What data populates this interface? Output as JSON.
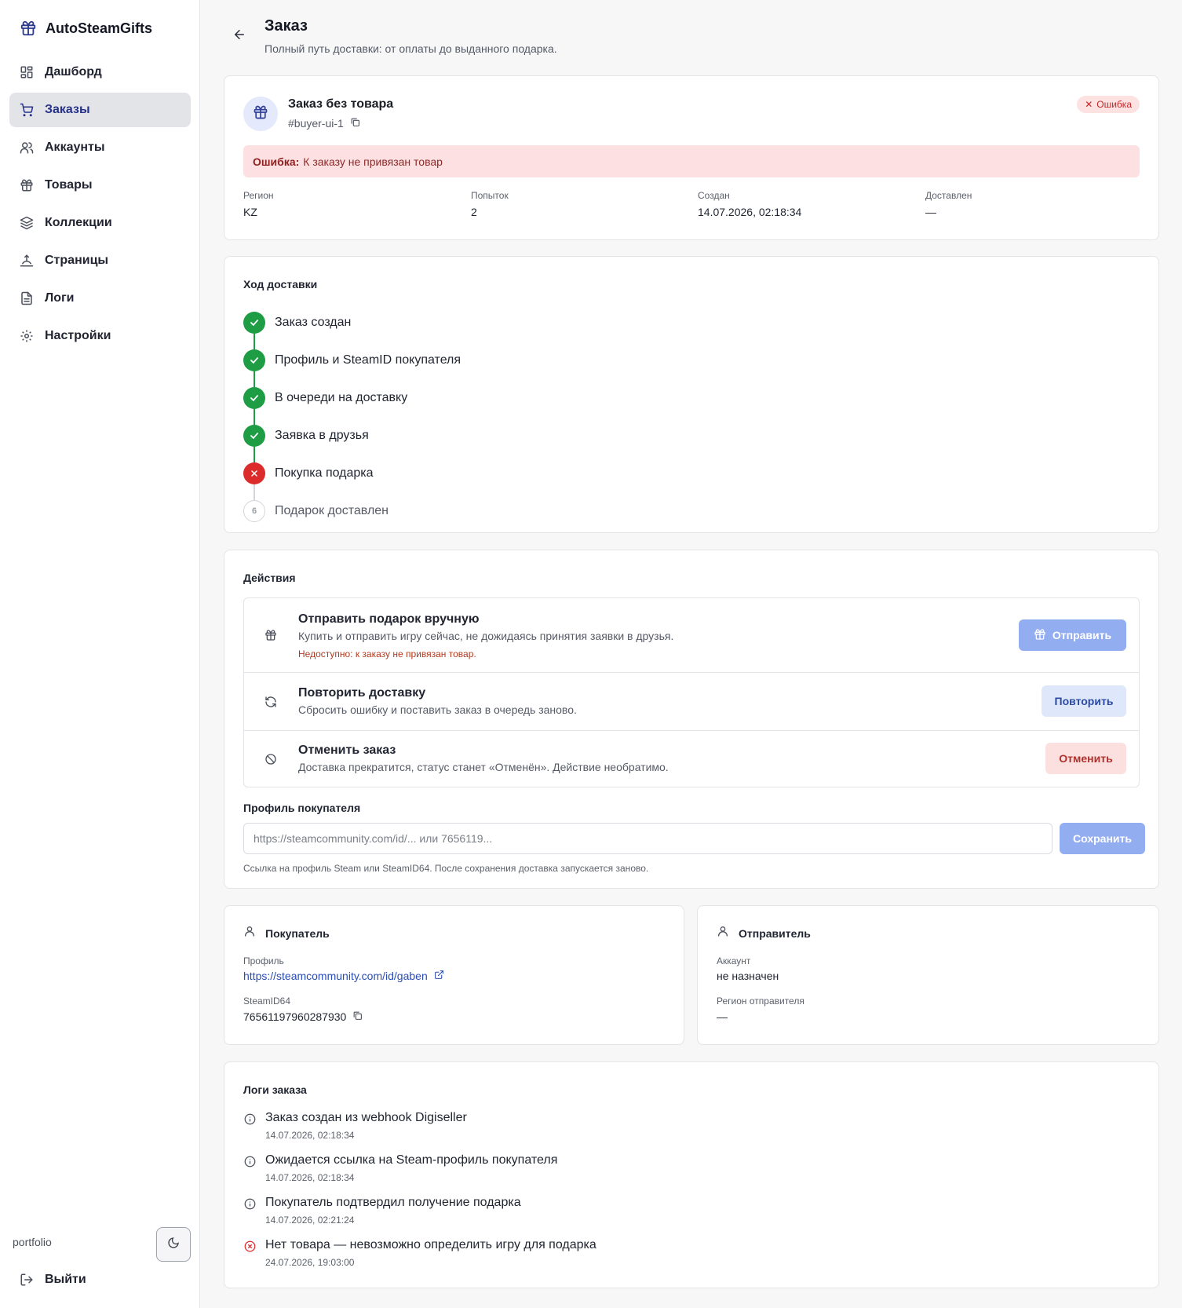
{
  "app": {
    "title": "AutoSteamGifts"
  },
  "sidebar": {
    "items": [
      {
        "label": "Дашборд",
        "icon": "dashboard-icon"
      },
      {
        "label": "Заказы",
        "icon": "cart-icon",
        "active": true
      },
      {
        "label": "Аккаунты",
        "icon": "users-icon"
      },
      {
        "label": "Товары",
        "icon": "gift-icon"
      },
      {
        "label": "Коллекции",
        "icon": "layers-icon"
      },
      {
        "label": "Страницы",
        "icon": "landing-icon"
      },
      {
        "label": "Логи",
        "icon": "file-text-icon"
      },
      {
        "label": "Настройки",
        "icon": "gear-icon"
      }
    ],
    "footer_user": "portfolio",
    "logout_label": "Выйти"
  },
  "header": {
    "title": "Заказ",
    "subtitle": "Полный путь доставки: от оплаты до выданного подарка."
  },
  "order": {
    "name": "Заказ без товара",
    "id": "#buyer-ui-1",
    "badge": "Ошибка",
    "error_prefix": "Ошибка:",
    "error_text": "К заказу не привязан товар",
    "meta": [
      {
        "label": "Регион",
        "value": "KZ"
      },
      {
        "label": "Попыток",
        "value": "2"
      },
      {
        "label": "Создан",
        "value": "14.07.2026, 02:18:34"
      },
      {
        "label": "Доставлен",
        "value": "—"
      }
    ]
  },
  "delivery": {
    "title": "Ход доставки",
    "steps": [
      {
        "label": "Заказ создан",
        "status": "done"
      },
      {
        "label": "Профиль и SteamID покупателя",
        "status": "done"
      },
      {
        "label": "В очереди на доставку",
        "status": "done"
      },
      {
        "label": "Заявка в друзья",
        "status": "done"
      },
      {
        "label": "Покупка подарка",
        "status": "error"
      },
      {
        "label": "Подарок доставлен",
        "status": "pending",
        "number": "6"
      }
    ]
  },
  "actions": {
    "title": "Действия",
    "items": [
      {
        "title": "Отправить подарок вручную",
        "description": "Купить и отправить игру сейчас, не дожидаясь принятия заявки в друзья.",
        "warning": "Недоступно: к заказу не привязан товар.",
        "button": "Отправить"
      },
      {
        "title": "Повторить доставку",
        "description": "Сбросить ошибку и поставить заказ в очередь заново.",
        "button": "Повторить"
      },
      {
        "title": "Отменить заказ",
        "description": "Доставка прекратится, статус станет «Отменён». Действие необратимо.",
        "button": "Отменить"
      }
    ],
    "profile_label": "Профиль покупателя",
    "profile_placeholder": "https://steamcommunity.com/id/... или 7656119...",
    "save_button": "Сохранить",
    "profile_hint": "Ссылка на профиль Steam или SteamID64. После сохранения доставка запускается заново."
  },
  "buyer": {
    "title": "Покупатель",
    "profile_label": "Профиль",
    "profile_url": "https://steamcommunity.com/id/gaben",
    "steamid_label": "SteamID64",
    "steamid": "76561197960287930"
  },
  "sender": {
    "title": "Отправитель",
    "account_label": "Аккаунт",
    "account_value": "не назначен",
    "region_label": "Регион отправителя",
    "region_value": "—"
  },
  "logs": {
    "title": "Логи заказа",
    "items": [
      {
        "text": "Заказ создан из webhook Digiseller",
        "time": "14.07.2026, 02:18:34",
        "level": "info"
      },
      {
        "text": "Ожидается ссылка на Steam-профиль покупателя",
        "time": "14.07.2026, 02:18:34",
        "level": "info"
      },
      {
        "text": "Покупатель подтвердил получение подарка",
        "time": "14.07.2026, 02:21:24",
        "level": "info"
      },
      {
        "text": "Нет товара — невозможно определить игру для подарка",
        "time": "24.07.2026, 19:03:00",
        "level": "error"
      }
    ]
  },
  "colors": {
    "accent": "#27318a",
    "success": "#1f9d45",
    "danger": "#dc2b2b",
    "error_bg": "#fde0e1"
  }
}
